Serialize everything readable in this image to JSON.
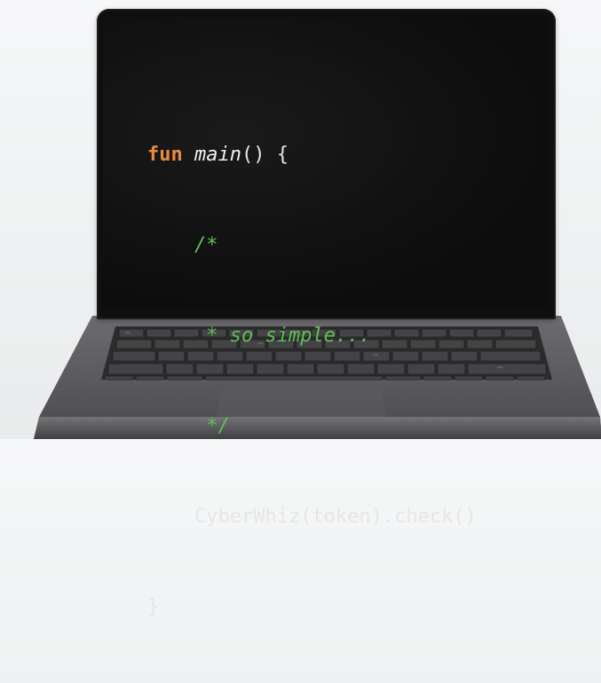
{
  "code": {
    "line1": {
      "keyword": "fun",
      "function_name": "main",
      "rest": "() {"
    },
    "line2": {
      "comment": "/*"
    },
    "line3": {
      "comment": "* so simple..."
    },
    "line4": {
      "comment": "*/"
    },
    "line5": {
      "statement": "CyberWhiz(token).check()"
    },
    "line6": {
      "brace": "}"
    }
  },
  "colors": {
    "keyword": "#e98b3d",
    "comment": "#5fbf54",
    "text": "#e6e6e6",
    "screen": "#0f0f10",
    "laptop_body": "#5a5a5c"
  },
  "icons": [
    "laptop-icon",
    "keyboard-icon"
  ]
}
